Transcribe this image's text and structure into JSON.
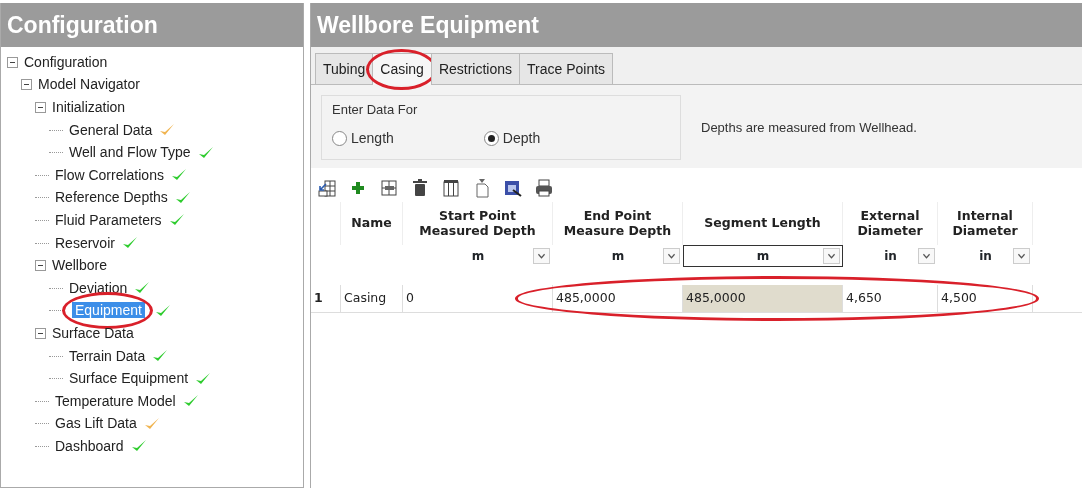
{
  "left_panel": {
    "title": "Configuration",
    "tree": [
      {
        "label": "Configuration",
        "expanded": true,
        "selected": false,
        "circled": false,
        "children": [
          {
            "label": "Model Navigator",
            "expanded": true,
            "selected": false,
            "circled": false,
            "children": [
              {
                "label": "Initialization",
                "expanded": true,
                "selected": false,
                "circled": false,
                "children": [
                  {
                    "label": "General Data",
                    "selected": false,
                    "circled": false,
                    "color": "#f0b450"
                  },
                  {
                    "label": "Well and Flow Type",
                    "selected": false,
                    "circled": false,
                    "color": "#2ecc2e"
                  }
                ]
              },
              {
                "label": "Flow Correlations",
                "selected": false,
                "circled": false,
                "color": "#2ecc2e"
              },
              {
                "label": "Reference Depths",
                "selected": false,
                "circled": false,
                "color": "#2ecc2e"
              },
              {
                "label": "Fluid Parameters",
                "selected": false,
                "circled": false,
                "color": "#2ecc2e"
              },
              {
                "label": "Reservoir",
                "selected": false,
                "circled": false,
                "color": "#2ecc2e"
              },
              {
                "label": "Wellbore",
                "expanded": true,
                "selected": false,
                "circled": false,
                "children": [
                  {
                    "label": "Deviation",
                    "selected": false,
                    "circled": false,
                    "color": "#2ecc2e"
                  },
                  {
                    "label": "Equipment",
                    "selected": true,
                    "circled": true,
                    "color": "#2ecc2e"
                  }
                ]
              },
              {
                "label": "Surface Data",
                "expanded": true,
                "selected": false,
                "circled": false,
                "children": [
                  {
                    "label": "Terrain Data",
                    "selected": false,
                    "circled": false,
                    "color": "#2ecc2e"
                  },
                  {
                    "label": "Surface Equipment",
                    "selected": false,
                    "circled": false,
                    "color": "#2ecc2e"
                  }
                ]
              },
              {
                "label": "Temperature Model",
                "selected": false,
                "circled": false,
                "color": "#2ecc2e"
              },
              {
                "label": "Gas Lift Data",
                "selected": false,
                "circled": false,
                "color": "#f0b450"
              },
              {
                "label": "Dashboard",
                "selected": false,
                "circled": false,
                "color": "#2ecc2e"
              }
            ]
          }
        ]
      }
    ]
  },
  "main_panel": {
    "title": "Wellbore Equipment",
    "tabs": [
      {
        "label": "Tubing",
        "selected": false,
        "circled": false
      },
      {
        "label": "Casing",
        "selected": true,
        "circled": true
      },
      {
        "label": "Restrictions",
        "selected": false,
        "circled": false
      },
      {
        "label": "Trace Points",
        "selected": false,
        "circled": false
      }
    ],
    "enter_data_for": {
      "legend": "Enter Data For",
      "options": [
        {
          "label": "Length",
          "selected": false
        },
        {
          "label": "Depth",
          "selected": true
        }
      ]
    },
    "note": "Depths are measured from Wellhead.",
    "toolbar": [
      {
        "kind": "import"
      },
      {
        "kind": "add"
      },
      {
        "kind": "insert"
      },
      {
        "kind": "delete"
      },
      {
        "kind": "columns"
      },
      {
        "kind": "document"
      },
      {
        "kind": "chart"
      },
      {
        "kind": "print"
      }
    ],
    "table": {
      "columns": [
        {
          "label": "Name",
          "readonly": false
        },
        {
          "label": "Start Point Measured Depth",
          "unit": "m",
          "unit_selected": false,
          "readonly": false
        },
        {
          "label": "End Point Measure Depth",
          "unit": "m",
          "unit_selected": false,
          "readonly": false
        },
        {
          "label": "Segment Length",
          "unit": "m",
          "unit_selected": true,
          "readonly": true
        },
        {
          "label": "External Diameter",
          "unit": "in",
          "unit_selected": false,
          "readonly": false
        },
        {
          "label": "Internal Diameter",
          "unit": "in",
          "unit_selected": false,
          "readonly": false
        }
      ],
      "rows": [
        {
          "number": "1",
          "cells": [
            {
              "text": "Casing",
              "circled": false
            },
            {
              "text": "0",
              "circled": false
            },
            {
              "text": "485,0000",
              "circled": true
            },
            {
              "text": "485,0000",
              "circled": true
            },
            {
              "text": "4,650",
              "circled": true
            },
            {
              "text": "4,500",
              "circled": true
            }
          ]
        }
      ]
    }
  }
}
